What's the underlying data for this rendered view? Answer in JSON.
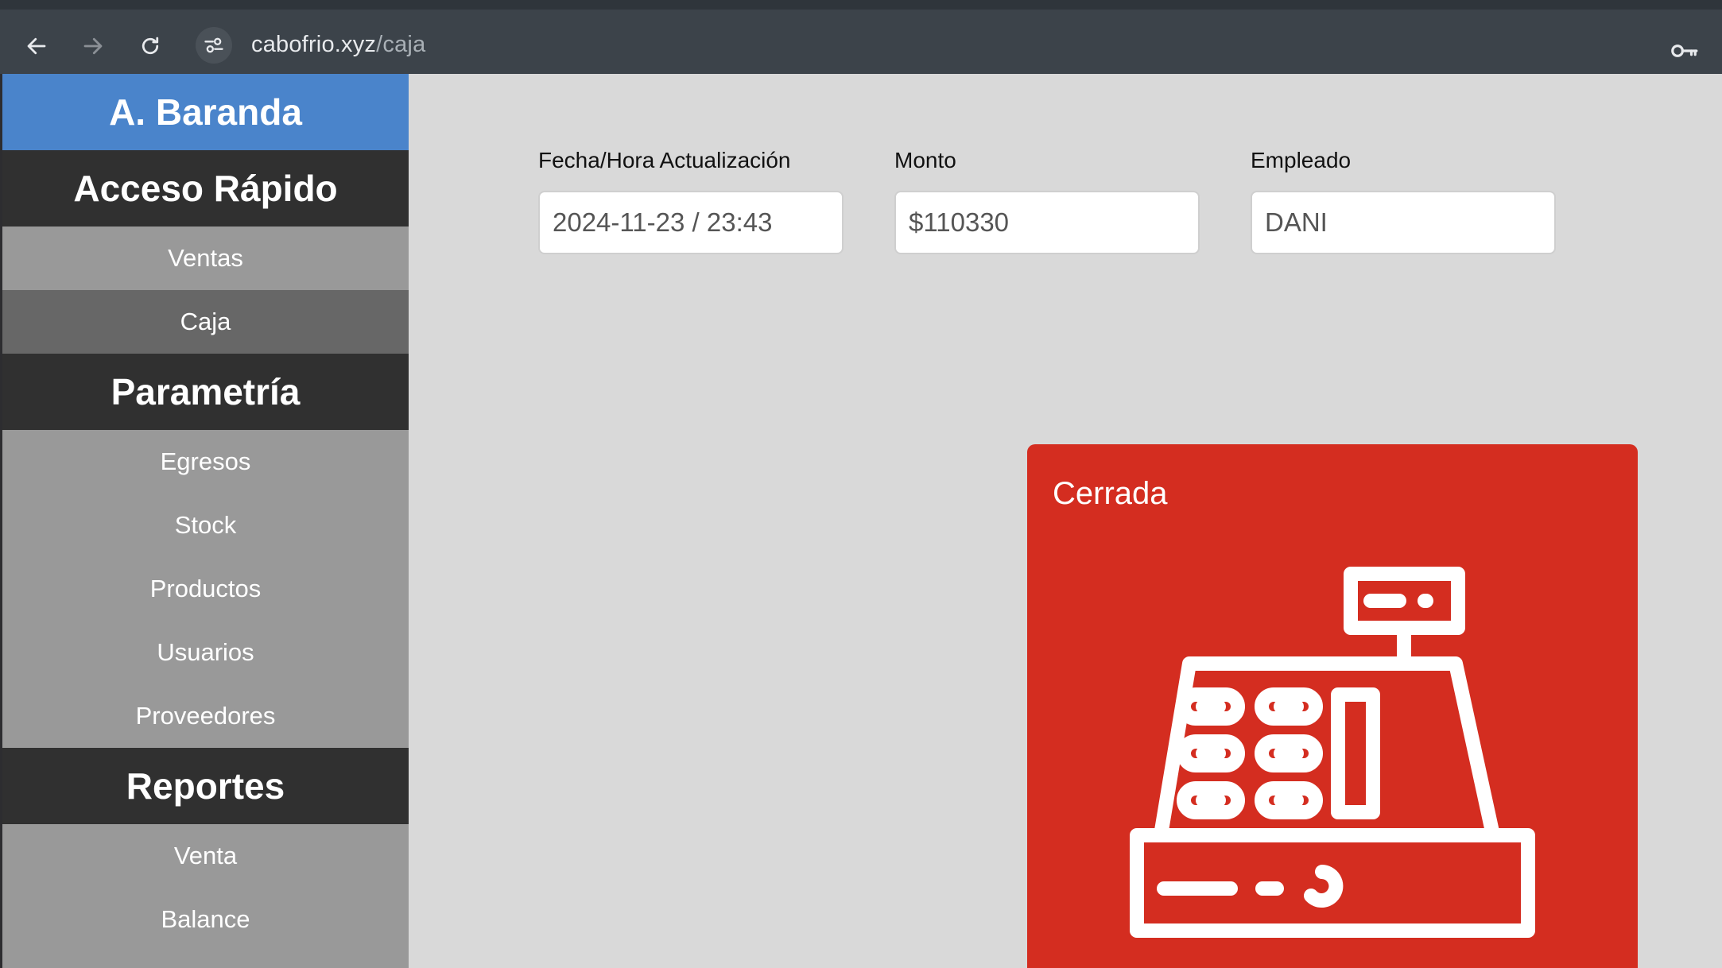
{
  "browser": {
    "url_host": "cabofrio.xyz",
    "url_path": "/caja",
    "icons": [
      "back-arrow-icon",
      "forward-arrow-icon",
      "reload-icon",
      "site-settings-icon",
      "key-icon"
    ]
  },
  "sidebar": {
    "brand": "A. Baranda",
    "sections": [
      {
        "title": "Acceso Rápido",
        "items": [
          "Ventas",
          "Caja"
        ]
      },
      {
        "title": "Parametría",
        "items": [
          "Egresos",
          "Stock",
          "Productos",
          "Usuarios",
          "Proveedores"
        ]
      },
      {
        "title": "Reportes",
        "items": [
          "Venta",
          "Balance"
        ]
      }
    ],
    "active_item": "Caja"
  },
  "form": {
    "fecha_label": "Fecha/Hora Actualización",
    "fecha_value": "2024-11-23 / 23:43",
    "monto_label": "Monto",
    "monto_value": "$110330",
    "empleado_label": "Empleado",
    "empleado_value": "DANI"
  },
  "status_card": {
    "title": "Cerrada",
    "color": "#d42d20",
    "icon": "cash-register-icon"
  },
  "colors": {
    "brand": "#4a84cb",
    "section_bg": "#303030",
    "sidebar_bg": "#999999",
    "active_item_bg": "#676767"
  }
}
